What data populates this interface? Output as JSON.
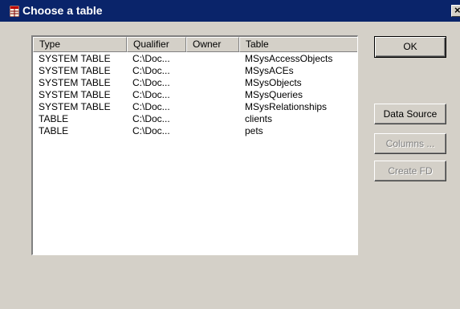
{
  "window": {
    "title": "Choose a table",
    "close_glyph": "×",
    "title_icon": "table-icon"
  },
  "listview": {
    "columns": [
      "Type",
      "Qualifier",
      "Owner",
      "Table"
    ],
    "rows": [
      {
        "type": "SYSTEM TABLE",
        "qualifier": "C:\\Doc...",
        "owner": "",
        "table": "MSysAccessObjects"
      },
      {
        "type": "SYSTEM TABLE",
        "qualifier": "C:\\Doc...",
        "owner": "",
        "table": "MSysACEs"
      },
      {
        "type": "SYSTEM TABLE",
        "qualifier": "C:\\Doc...",
        "owner": "",
        "table": "MSysObjects"
      },
      {
        "type": "SYSTEM TABLE",
        "qualifier": "C:\\Doc...",
        "owner": "",
        "table": "MSysQueries"
      },
      {
        "type": "SYSTEM TABLE",
        "qualifier": "C:\\Doc...",
        "owner": "",
        "table": "MSysRelationships"
      },
      {
        "type": "TABLE",
        "qualifier": "C:\\Doc...",
        "owner": "",
        "table": "clients"
      },
      {
        "type": "TABLE",
        "qualifier": "C:\\Doc...",
        "owner": "",
        "table": "pets"
      }
    ]
  },
  "buttons": {
    "ok": "OK",
    "data_source": "Data Source",
    "columns": "Columns ...",
    "create_fd": "Create FD"
  },
  "colors": {
    "title_bar": "#0a246a",
    "dialog_bg": "#d4d0c8",
    "disabled_text": "#808080"
  }
}
